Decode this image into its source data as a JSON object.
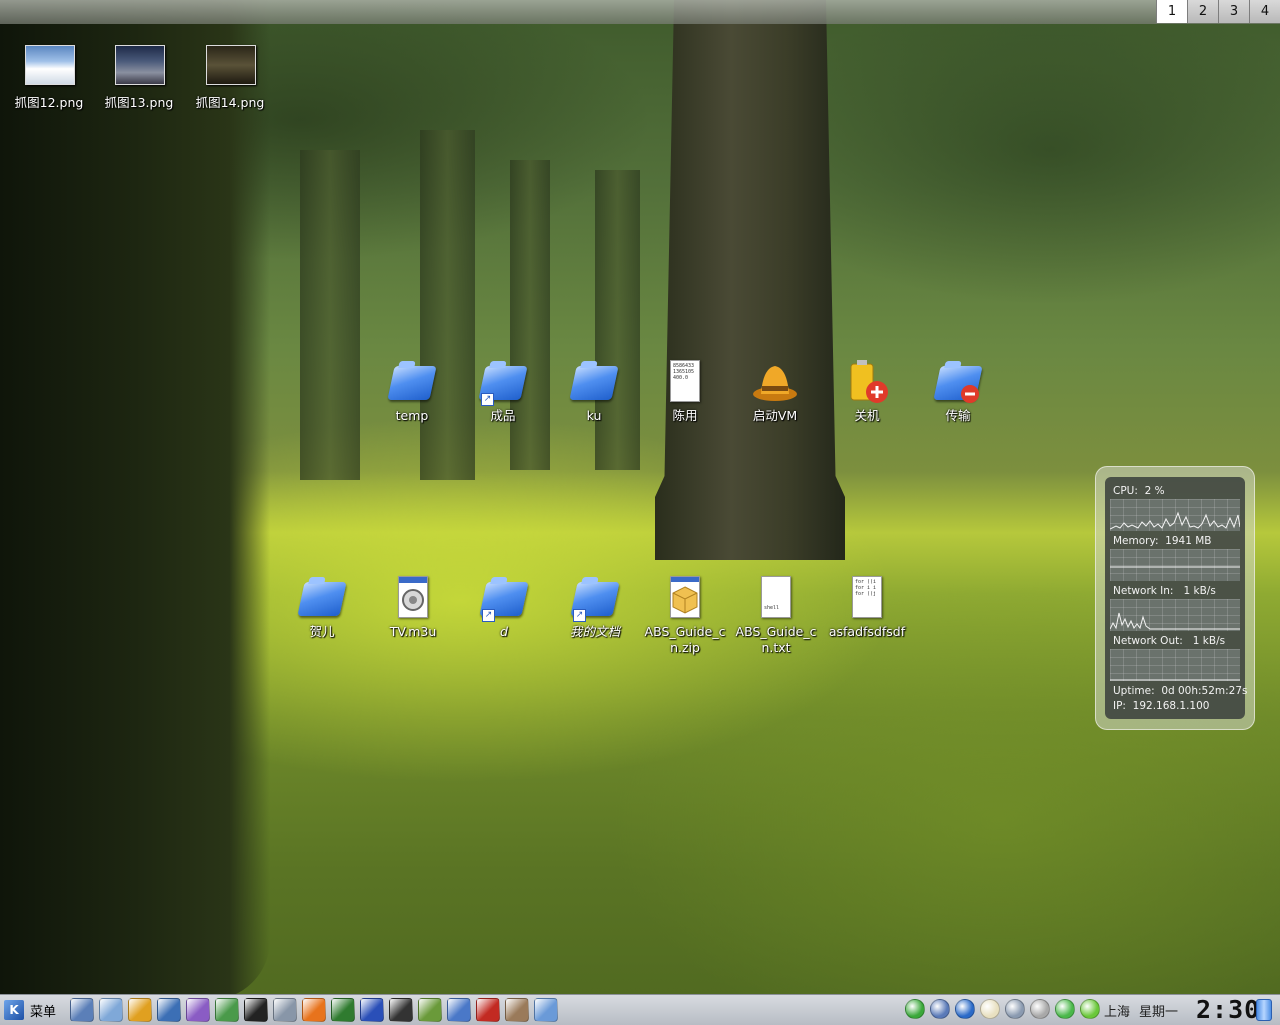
{
  "pager": {
    "desktops": [
      "1",
      "2",
      "3",
      "4"
    ],
    "active": "1"
  },
  "desktop_icons": {
    "screenshot12": "抓图12.png",
    "screenshot13": "抓图13.png",
    "screenshot14": "抓图14.png",
    "temp": "temp",
    "chengpin": "成品",
    "ku": "ku",
    "chenyong": "陈用",
    "start_vm": "启动VM",
    "shutdown": "关机",
    "transfer": "传输",
    "heer": "贺儿",
    "tv_m3u": "TV.m3u",
    "d": "d",
    "my_documents": "我的文档",
    "abs_zip": "ABS_Guide_cn.zip",
    "abs_txt": "ABS_Guide_cn.txt",
    "asdf": "asfadfsdfsdf"
  },
  "icon_file_snippets": {
    "chenyong": "8586433 1365105 400.0",
    "abs_txt": "shell",
    "asdf": "for ((i for i i for ((j"
  },
  "monitor": {
    "cpu_label": "CPU:",
    "cpu_value": "2 %",
    "memory_label": "Memory:",
    "memory_value": "1941 MB",
    "net_in_label": "Network In:",
    "net_in_value": "1 kB/s",
    "net_out_label": "Network Out:",
    "net_out_value": "1 kB/s",
    "uptime_label": "Uptime:",
    "uptime_value": "0d 00h:52m:27s",
    "ip_label": "IP:",
    "ip_value": "192.168.1.100"
  },
  "taskbar": {
    "menu_label": "菜单",
    "launchers": [
      {
        "name": "monitor-app-icon",
        "color": "#5b7fb8"
      },
      {
        "name": "paint-brush-icon",
        "color": "#7fa8d8"
      },
      {
        "name": "vm-hat-icon",
        "color": "#e0a020"
      },
      {
        "name": "thunderbird-icon",
        "color": "#3c6fb5"
      },
      {
        "name": "wizard-icon",
        "color": "#8a5cc4"
      },
      {
        "name": "network-computer-icon",
        "color": "#4a9a4a"
      },
      {
        "name": "qq-penguin-icon",
        "color": "#222222"
      },
      {
        "name": "printer-icon",
        "color": "#8896a8"
      },
      {
        "name": "firefox-icon",
        "color": "#e8731c"
      },
      {
        "name": "chart-app-icon",
        "color": "#2f7b2f"
      },
      {
        "name": "hi-messenger-icon",
        "color": "#2a4fb8"
      },
      {
        "name": "terminal-icon",
        "color": "#333333"
      },
      {
        "name": "dictionary-icon",
        "color": "#6a9a3a"
      },
      {
        "name": "edit-tool-icon",
        "color": "#4a78c8"
      },
      {
        "name": "filezilla-icon",
        "color": "#c22a22"
      },
      {
        "name": "package-icon",
        "color": "#9a7a5a"
      },
      {
        "name": "network-app-icon",
        "color": "#6a9ad8"
      }
    ],
    "tray": [
      {
        "name": "color-dots-icon",
        "color": "#3aa83a"
      },
      {
        "name": "volume-icon",
        "color": "#5a7ab8"
      },
      {
        "name": "globe-icon",
        "color": "#2a6ac8"
      },
      {
        "name": "klipper-icon",
        "color": "#e8e0c0"
      },
      {
        "name": "network-status-icon",
        "color": "#8a9ab0"
      },
      {
        "name": "pen-icon",
        "color": "#a8a8a8"
      },
      {
        "name": "green-circle-icon",
        "color": "#4ab84a"
      },
      {
        "name": "check-icon",
        "color": "#6ac83a"
      }
    ],
    "city": "上海",
    "weekday": "星期一",
    "clock": "2:30"
  }
}
